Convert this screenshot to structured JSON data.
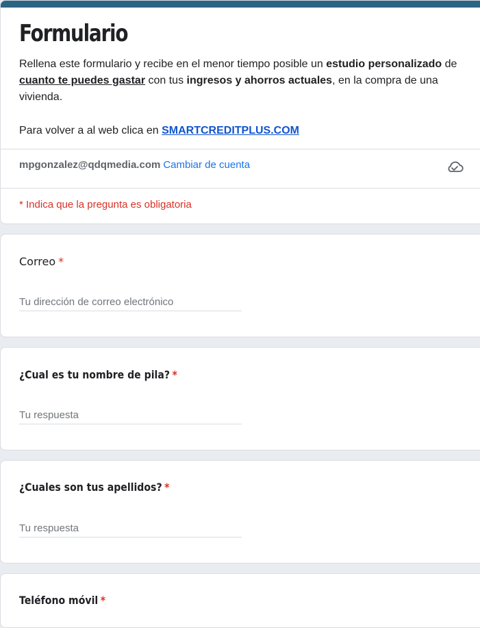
{
  "form": {
    "title": "Formulario",
    "description": {
      "p1": "Rellena este formulario y recibe en el menor tiempo posible un ",
      "p2_bold": "estudio personalizado",
      "p3": " de ",
      "p4_bold_underline": "cuanto te puedes gastar",
      "p5": " con tus ",
      "p6_bold": "ingresos y ahorros actuales",
      "p7": ", en la compra de una vivienda."
    },
    "back_text": "Para volver a al web clica en ",
    "back_link": "SMARTCREDITPLUS.COM",
    "account_email": "mpgonzalez@qdqmedia.com",
    "switch_account": "Cambiar de cuenta",
    "required_note": "* Indica que la pregunta es obligatoria"
  },
  "questions": [
    {
      "label": "Correo",
      "required_mark": "*",
      "placeholder": "Tu dirección de correo electrónico"
    },
    {
      "label": "¿Cual es tu nombre de pila?",
      "required_mark": "*",
      "placeholder": "Tu respuesta"
    },
    {
      "label": "¿Cuales son tus apellidos?",
      "required_mark": "*",
      "placeholder": "Tu respuesta"
    },
    {
      "label": "Teléfono móvil",
      "required_mark": "*"
    }
  ],
  "colors": {
    "accent": "#2b6583",
    "link": "#1155cc",
    "required": "#d93025",
    "background": "#e9edf2"
  },
  "icons": {
    "save_status": "cloud-check-icon"
  }
}
